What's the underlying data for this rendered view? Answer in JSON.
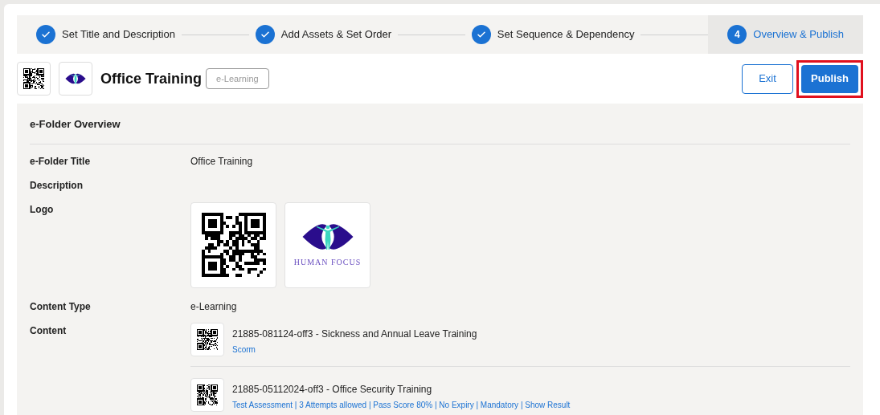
{
  "steps": [
    {
      "label": "Set Title and Description",
      "done": true,
      "selected": false
    },
    {
      "label": "Add Assets & Set Order",
      "done": true,
      "selected": false
    },
    {
      "label": "Set Sequence & Dependency",
      "done": true,
      "selected": false
    },
    {
      "label": "Overview & Publish",
      "number": "4",
      "done": false,
      "selected": true
    }
  ],
  "header": {
    "title": "Office Training",
    "badge": "e-Learning",
    "buttons": [
      {
        "label": "Exit",
        "kind": "outline",
        "highlighted": false
      },
      {
        "label": "Publish",
        "kind": "primary",
        "highlighted": true
      }
    ]
  },
  "overview": {
    "heading": "e-Folder Overview",
    "fields": [
      {
        "label": "e-Folder Title",
        "kind": "text",
        "value": "Office Training"
      },
      {
        "label": "Description",
        "kind": "text"
      },
      {
        "label": "Logo",
        "kind": "logos",
        "logo_caption": "HUMAN FOCUS"
      },
      {
        "label": "Content Type",
        "kind": "text",
        "value": "e-Learning"
      },
      {
        "label": "Content",
        "kind": "content",
        "items": [
          {
            "title": "21885-081124-off3 - Sickness and Annual Leave Training",
            "meta": "Scorm"
          },
          {
            "title": "21885-05112024-off3 - Office Security Training",
            "meta": "Test Assessment | 3 Attempts allowed | Pass Score 80% | No Expiry | Mandatory | Show Result"
          }
        ]
      }
    ]
  }
}
